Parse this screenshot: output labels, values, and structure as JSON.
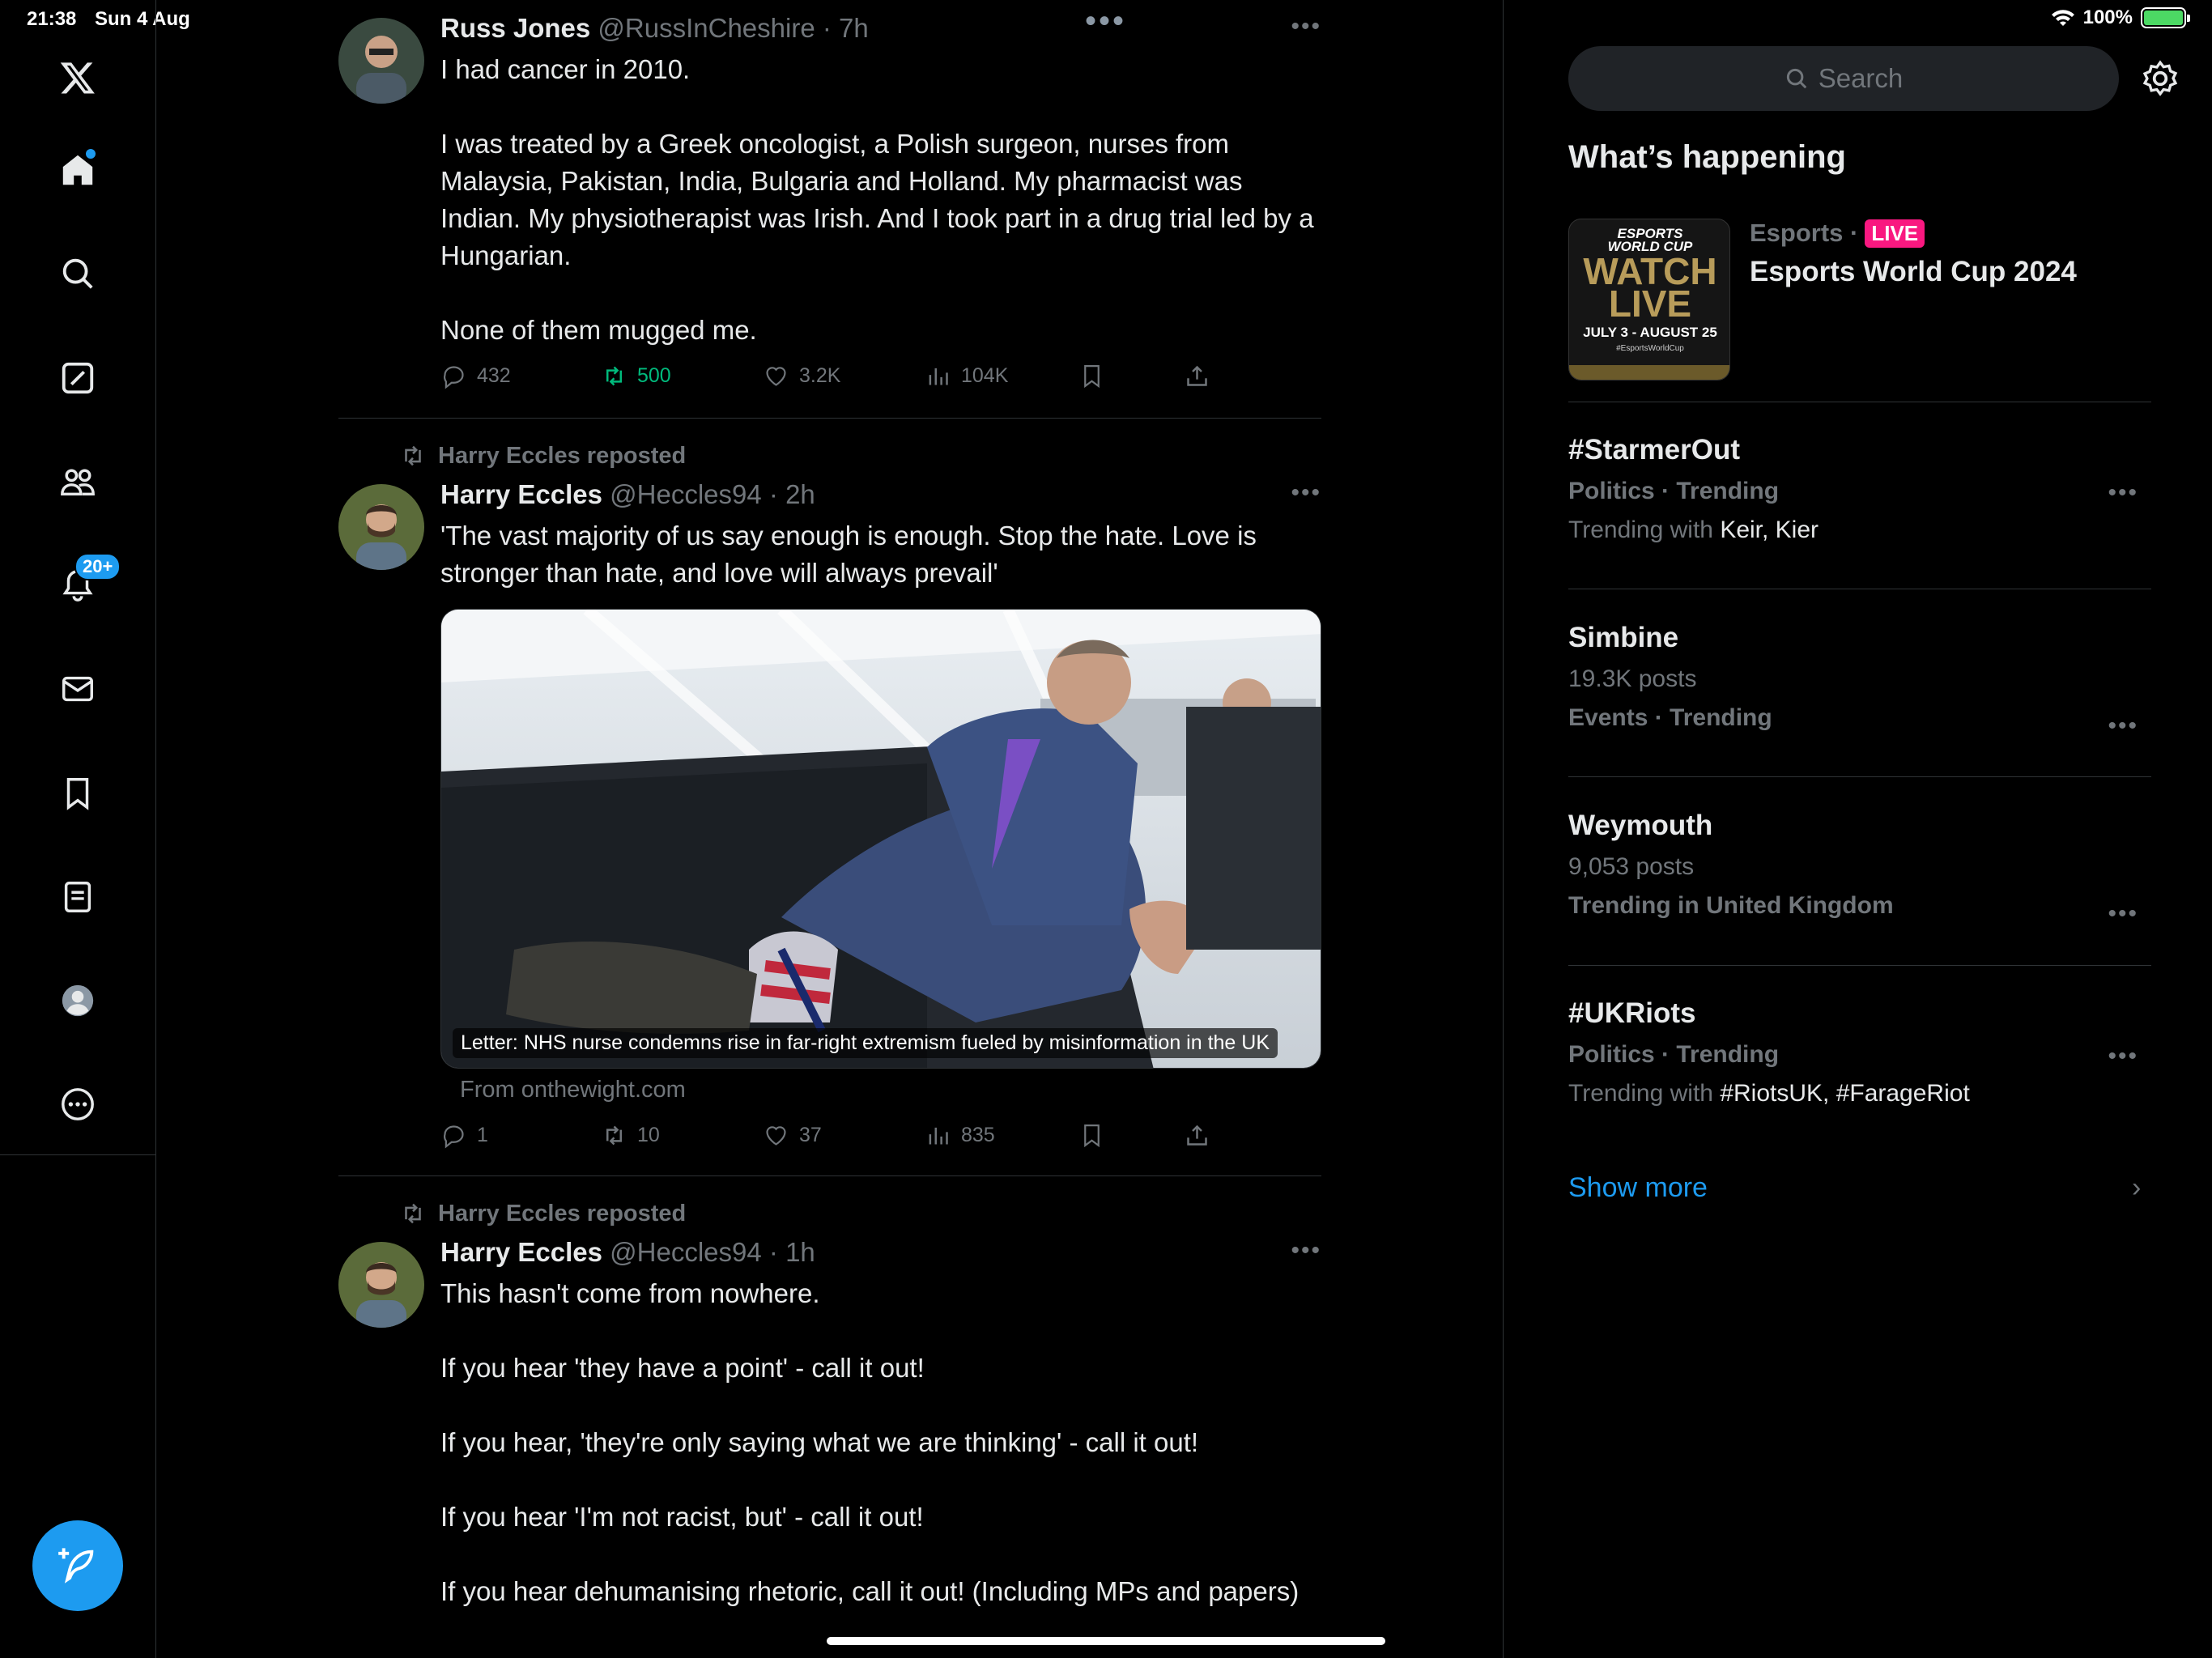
{
  "status_bar": {
    "time": "21:38",
    "date": "Sun 4 Aug",
    "battery": "100%"
  },
  "nav": {
    "notifications_badge": "20+"
  },
  "tweets": [
    {
      "name": "Russ Jones",
      "handle": "@RussInCheshire",
      "time": "· 7h",
      "text": "I had cancer in 2010.\n\nI was treated by a Greek oncologist, a Polish surgeon, nurses from Malaysia, Pakistan, India, Bulgaria and Holland. My pharmacist was Indian. My physiotherapist was Irish. And I took part in a drug trial led by a Hungarian.\n\nNone of them mugged me.",
      "replies": "432",
      "retweets": "500",
      "likes": "3.2K",
      "views": "104K"
    },
    {
      "repost_label": "Harry Eccles reposted",
      "name": "Harry Eccles",
      "handle": "@Heccles94",
      "time": "· 2h",
      "text": "'The vast majority of us say enough is enough. Stop the hate. Love is stronger than hate, and love will always prevail'",
      "media_caption": "Letter: NHS nurse condemns rise in far-right extremism fueled by misinformation in the UK",
      "media_source": "From onthewight.com",
      "replies": "1",
      "retweets": "10",
      "likes": "37",
      "views": "835"
    },
    {
      "repost_label": "Harry Eccles reposted",
      "name": "Harry Eccles",
      "handle": "@Heccles94",
      "time": "· 1h",
      "text": "This hasn't come from nowhere.\n\nIf you hear 'they have a point' - call it out!\n\nIf you hear, 'they're only saying what we are thinking' - call it out!\n\nIf you hear 'I'm not racist, but' - call it out!\n\nIf you hear dehumanising rhetoric, call it out! (Including MPs and papers)"
    }
  ],
  "search": {
    "placeholder": "Search"
  },
  "whats_happening": {
    "title": "What’s happening",
    "featured": {
      "category": "Esports ·",
      "live": "LIVE",
      "title": "Esports World Cup 2024",
      "thumb_line1": "ESPORTS",
      "thumb_line2": "WORLD CUP",
      "thumb_watch": "WATCH",
      "thumb_live": "LIVE",
      "thumb_dates": "JULY 3 - AUGUST 25",
      "thumb_tag": "#EsportsWorldCup"
    },
    "trends": [
      {
        "name": "#StarmerOut",
        "line1": "Politics · Trending",
        "with_label": "Trending with ",
        "with_terms": "Keir, Kier"
      },
      {
        "name": "Simbine",
        "line1": "19.3K posts",
        "line2": "Events · Trending"
      },
      {
        "name": "Weymouth",
        "line1": "9,053 posts",
        "line2": "Trending in United Kingdom"
      },
      {
        "name": "#UKRiots",
        "line1": "Politics · Trending",
        "with_label": "Trending with ",
        "with_terms": "#RiotsUK, #FarageRiot"
      }
    ],
    "show_more": "Show more"
  }
}
